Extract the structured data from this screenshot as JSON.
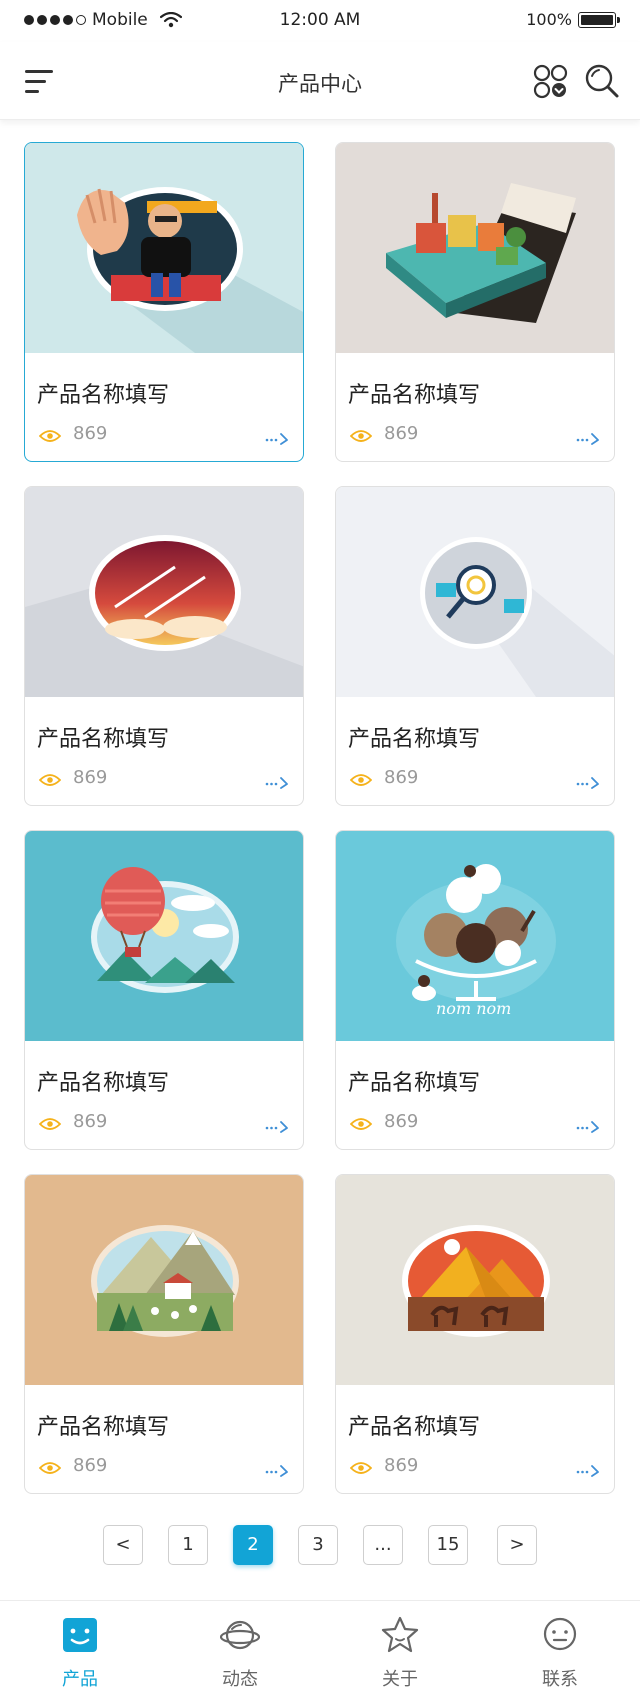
{
  "status_bar": {
    "carrier": "Mobile",
    "time": "12:00 AM",
    "battery": "100%"
  },
  "header": {
    "title": "产品中心"
  },
  "products": [
    {
      "name": "产品名称填写",
      "views": "869",
      "image": "entrance-guard-illustration",
      "active": true
    },
    {
      "name": "产品名称填写",
      "views": "869",
      "image": "city-notebook-illustration",
      "active": false
    },
    {
      "name": "产品名称填写",
      "views": "869",
      "image": "rocket-sky-illustration",
      "active": false
    },
    {
      "name": "产品名称填写",
      "views": "869",
      "image": "data-magnifier-illustration",
      "active": false
    },
    {
      "name": "产品名称填写",
      "views": "869",
      "image": "hot-air-balloon-illustration",
      "active": false
    },
    {
      "name": "产品名称填写",
      "views": "869",
      "image": "ice-cream-illustration",
      "active": false,
      "caption": "nom nom"
    },
    {
      "name": "产品名称填写",
      "views": "869",
      "image": "mountain-village-illustration",
      "active": false
    },
    {
      "name": "产品名称填写",
      "views": "869",
      "image": "desert-pyramids-illustration",
      "active": false
    }
  ],
  "pagination": {
    "prev": "<",
    "pages": [
      "1",
      "2",
      "3",
      "...",
      "15"
    ],
    "current": "2",
    "next": ">"
  },
  "tabs": [
    {
      "label": "产品",
      "icon": "smile-box-icon",
      "active": true
    },
    {
      "label": "动态",
      "icon": "planet-icon",
      "active": false
    },
    {
      "label": "关于",
      "icon": "star-icon",
      "active": false
    },
    {
      "label": "联系",
      "icon": "chat-face-icon",
      "active": false
    }
  ],
  "colors": {
    "accent": "#12a4d6",
    "eye": "#f5b21b",
    "arrow": "#3f8fd6"
  }
}
